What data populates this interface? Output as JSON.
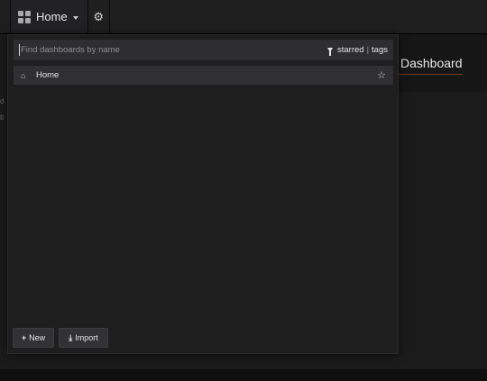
{
  "navbar": {
    "dashboard_title": "Home",
    "icons": {
      "picker": "dashboard-grid-icon",
      "caret": "caret-down-icon",
      "settings": "gear-icon"
    }
  },
  "search": {
    "placeholder": "Find dashboards by name",
    "value": "",
    "filter_starred": "starred",
    "filter_separator": "|",
    "filter_tags": "tags",
    "filter_icon": "filter-funnel-icon"
  },
  "results": [
    {
      "icon": "home-icon",
      "label": "Home",
      "starred": false
    }
  ],
  "actions": {
    "new_label": "New",
    "import_label": "Import",
    "new_icon": "plus-icon",
    "import_icon": "download-icon"
  },
  "background": {
    "title": "Dashboard",
    "accent": "#6e3b1c"
  }
}
